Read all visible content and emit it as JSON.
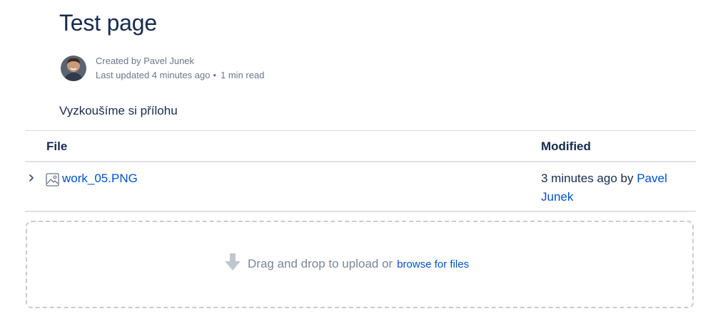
{
  "page": {
    "title": "Test page",
    "created_by": "Created by Pavel Junek",
    "last_updated": "Last updated 4 minutes ago",
    "bullet": "•",
    "read_time": "1 min read",
    "intro_text": "Vyzkoušíme si přílohu"
  },
  "attachments_table": {
    "columns": [
      "File",
      "Modified"
    ],
    "rows": [
      {
        "file_name": "work_05.PNG",
        "file_icon": "image-file-icon",
        "modified_prefix": "3 minutes ago by",
        "modified_user": "Pavel Junek"
      }
    ]
  },
  "upload": {
    "icon": "download-arrow-icon",
    "text": "Drag and drop to upload or",
    "browse_label": "browse for files"
  },
  "colors": {
    "link": "#0052cc",
    "text": "#172b4d",
    "muted": "#6b778c",
    "border": "#dfe1e6"
  }
}
